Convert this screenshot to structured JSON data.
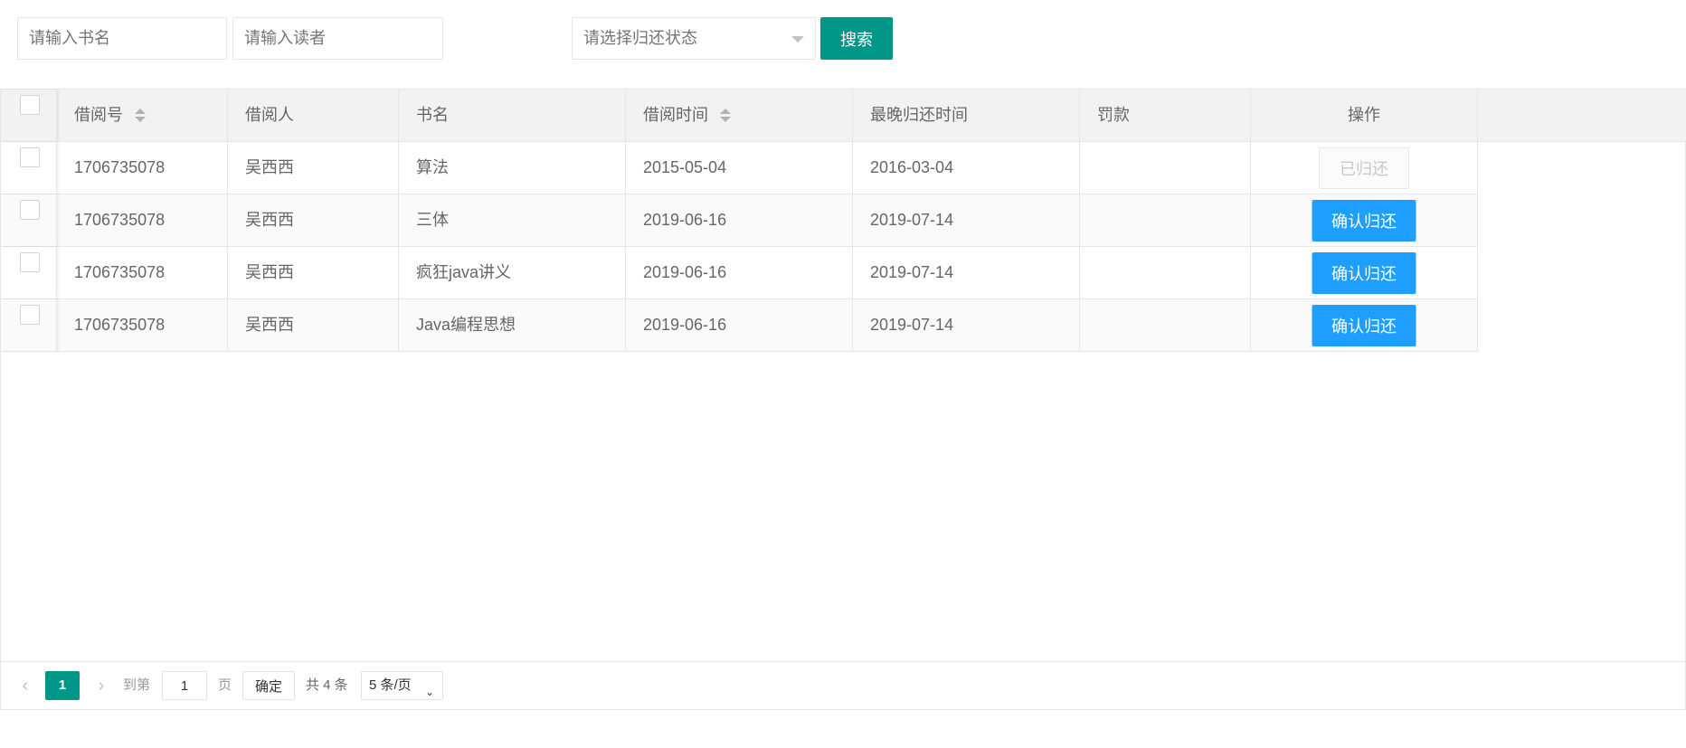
{
  "search": {
    "book_placeholder": "请输入书名",
    "reader_placeholder": "请输入读者",
    "status_placeholder": "请选择归还状态",
    "search_label": "搜索"
  },
  "table": {
    "headers": {
      "borrow_id": "借阅号",
      "borrower": "借阅人",
      "book_name": "书名",
      "borrow_time": "借阅时间",
      "latest_return_time": "最晚归还时间",
      "fine": "罚款",
      "operation": "操作"
    },
    "rows": [
      {
        "borrow_id": "1706735078",
        "borrower": "吴西西",
        "book_name": "算法",
        "borrow_time": "2015-05-04",
        "latest_return_time": "2016-03-04",
        "fine": "",
        "action": "已归还"
      },
      {
        "borrow_id": "1706735078",
        "borrower": "吴西西",
        "book_name": "三体",
        "borrow_time": "2019-06-16",
        "latest_return_time": "2019-07-14",
        "fine": "",
        "action": "确认归还"
      },
      {
        "borrow_id": "1706735078",
        "borrower": "吴西西",
        "book_name": "疯狂java讲义",
        "borrow_time": "2019-06-16",
        "latest_return_time": "2019-07-14",
        "fine": "",
        "action": "确认归还"
      },
      {
        "borrow_id": "1706735078",
        "borrower": "吴西西",
        "book_name": "Java编程思想",
        "borrow_time": "2019-06-16",
        "latest_return_time": "2019-07-14",
        "fine": "",
        "action": "确认归还"
      }
    ]
  },
  "pagination": {
    "prev_icon": "‹",
    "next_icon": "›",
    "current_page": "1",
    "goto_label": "到第",
    "goto_value": "1",
    "page_label": "页",
    "confirm_label": "确定",
    "total_label": "共 4 条",
    "page_size": "5 条/页"
  },
  "colors": {
    "primary": "#009688",
    "confirm_button": "#1e9fff"
  }
}
